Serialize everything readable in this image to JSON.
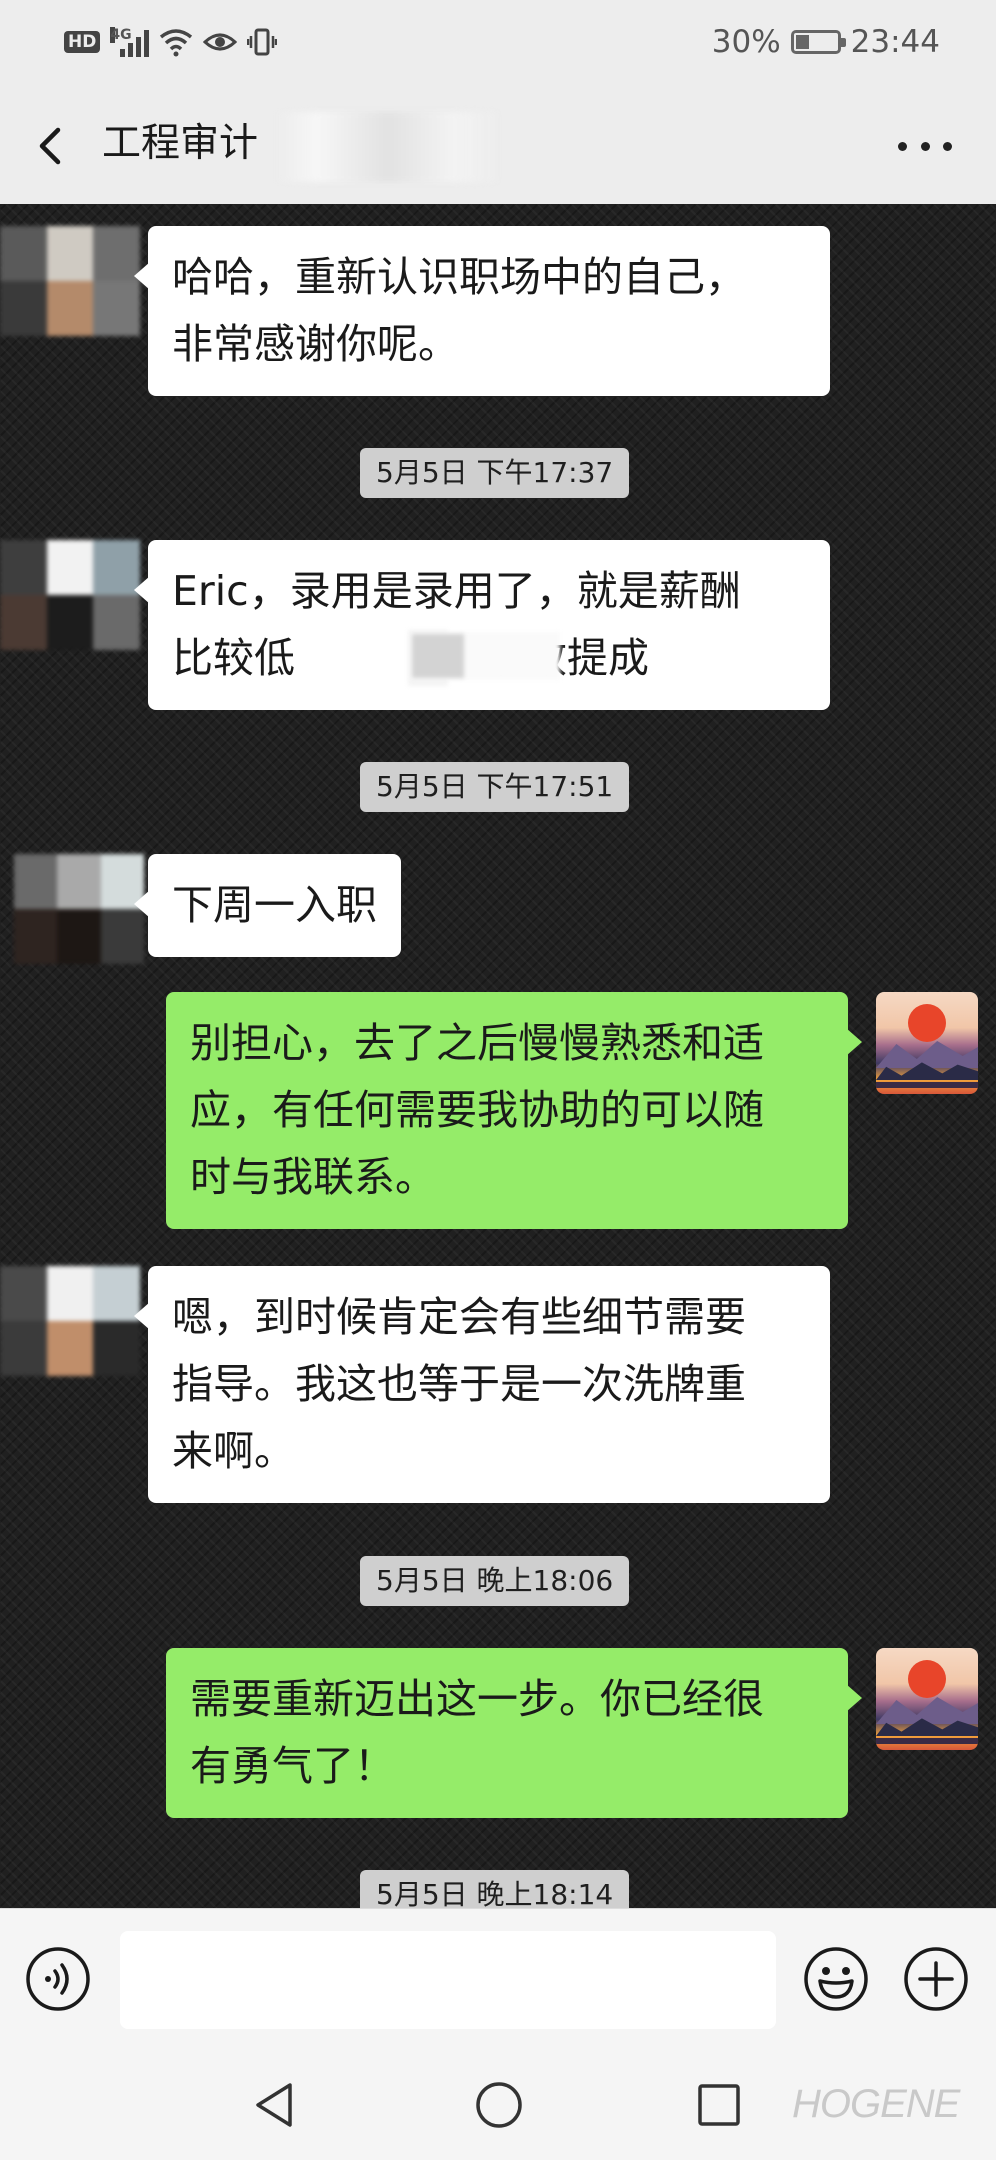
{
  "status_bar": {
    "hd": "HD",
    "network": "4G",
    "battery": "30%",
    "battery_level": 0.3,
    "time": "23:44"
  },
  "header": {
    "title": "工程审计",
    "back_icon": "chevron-left-icon",
    "more_icon": "more-dots-icon"
  },
  "messages": [
    {
      "side": "left",
      "lines": [
        "哈哈，重新认识职场中的自己，",
        "非常感谢你呢。"
      ]
    },
    {
      "type": "time",
      "text": "5月5日 下午17:37"
    },
    {
      "side": "left",
      "lines": [
        "Eric，录用是录用了，就是薪酬",
        "比较低",
        "绩效提成"
      ]
    },
    {
      "type": "time",
      "text": "5月5日 下午17:51"
    },
    {
      "side": "left",
      "lines": [
        "下周一入职"
      ]
    },
    {
      "side": "right",
      "lines": [
        "别担心，去了之后慢慢熟悉和适",
        "应，有任何需要我协助的可以随",
        "时与我联系。"
      ]
    },
    {
      "side": "left",
      "lines": [
        "嗯，到时候肯定会有些细节需要",
        "指导。我这也等于是一次洗牌重",
        "来啊。"
      ]
    },
    {
      "type": "time",
      "text": "5月5日 晚上18:06"
    },
    {
      "side": "right",
      "lines": [
        "需要重新迈出这一步。你已经很",
        "有勇气了！"
      ]
    },
    {
      "type": "time",
      "text": "5月5日 晚上18:14"
    }
  ],
  "input_bar": {
    "voice_icon": "voice-icon",
    "emoji_icon": "emoji-icon",
    "plus_icon": "plus-circle-icon",
    "value": ""
  },
  "nav_bar": {
    "back_icon": "nav-back-icon",
    "home_icon": "nav-home-icon",
    "recent_icon": "nav-recent-icon"
  },
  "watermark": "HOGENE",
  "colors": {
    "self_bubble": "#95ec69",
    "other_bubble": "#ffffff",
    "timestamp_bg": "#cfcfcf",
    "header_bg": "#ededed"
  }
}
